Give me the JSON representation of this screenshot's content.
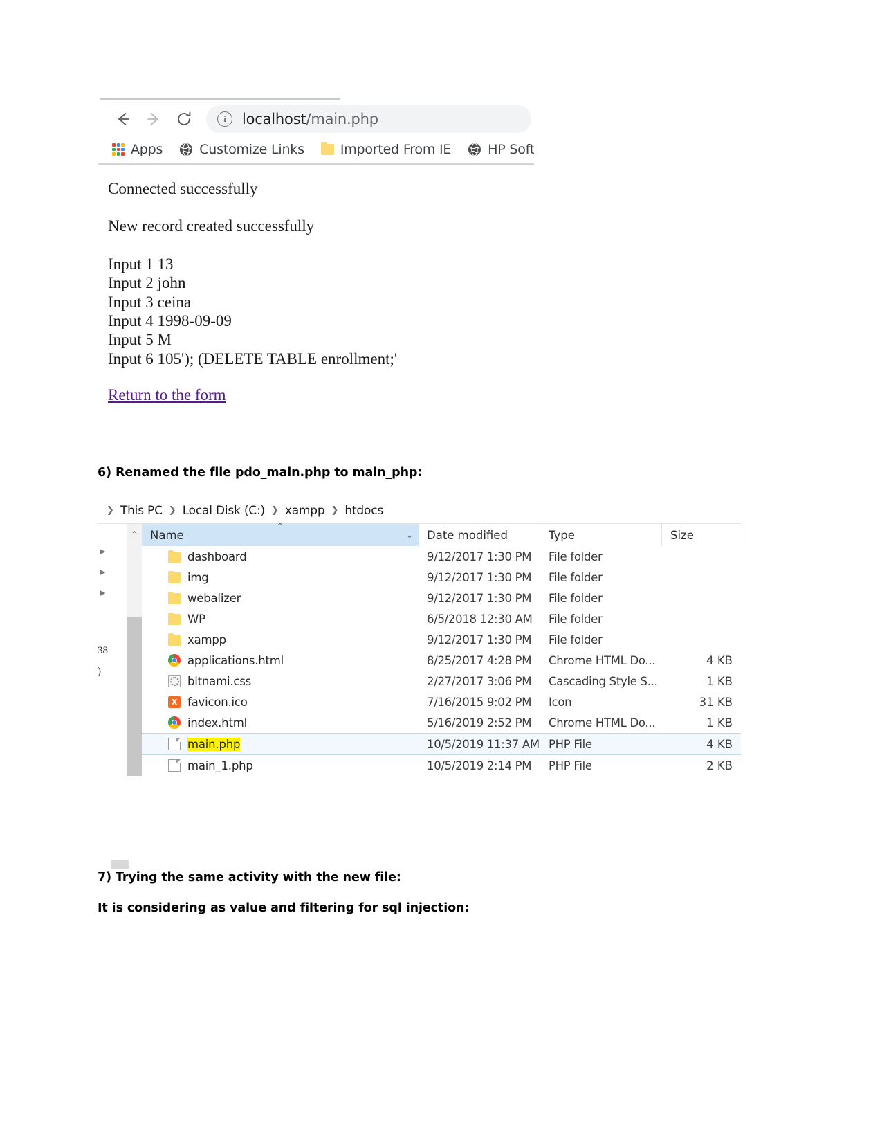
{
  "browser": {
    "nav": {
      "back_label": "←",
      "forward_label": "→",
      "reload_label": "C"
    },
    "omnibox": {
      "info_glyph": "i",
      "url_host": "localhost",
      "url_path": "/main.php"
    },
    "bookmarks": [
      {
        "label": "Apps",
        "icon": "apps-grid-icon"
      },
      {
        "label": "Customize Links",
        "icon": "globe-icon"
      },
      {
        "label": "Imported From IE",
        "icon": "folder-icon"
      },
      {
        "label": "HP Softwar",
        "icon": "globe-icon"
      }
    ],
    "page": {
      "connected_message": "Connected successfully",
      "record_message": "New record created successfully",
      "inputs": [
        "Input 1 13",
        "Input 2 john",
        "Input 3 ceina",
        "Input 4 1998-09-09",
        "Input 5 M",
        "Input 6 105'); (DELETE TABLE enrollment;'"
      ],
      "return_link": "Return to the form"
    }
  },
  "document": {
    "heading6": "6) Renamed the file pdo_main.php to main_php:",
    "heading7": "7) Trying the same activity with the new file:",
    "heading7b": "It is considering as value and filtering for sql injection:"
  },
  "explorer": {
    "breadcrumb": [
      "This PC",
      "Local Disk (C:)",
      "xampp",
      "htdocs"
    ],
    "breadcrumb_separator": "❯",
    "left_rail": {
      "tree_arrows": [
        "▶",
        "▶",
        "▶"
      ],
      "clipped_text": [
        "38",
        ")"
      ]
    },
    "scrollbar": {
      "up_arrow": "⌃"
    },
    "columns": {
      "name": "Name",
      "date_modified": "Date modified",
      "type": "Type",
      "size": "Size",
      "sort_caret": "⌃",
      "drop_caret": "⌄"
    },
    "rows": [
      {
        "name": "dashboard",
        "icon": "folder-icon",
        "date": "9/12/2017 1:30 PM",
        "type": "File folder",
        "size": "",
        "selected": false,
        "highlighted": false
      },
      {
        "name": "img",
        "icon": "folder-icon",
        "date": "9/12/2017 1:30 PM",
        "type": "File folder",
        "size": "",
        "selected": false,
        "highlighted": false
      },
      {
        "name": "webalizer",
        "icon": "folder-icon",
        "date": "9/12/2017 1:30 PM",
        "type": "File folder",
        "size": "",
        "selected": false,
        "highlighted": false
      },
      {
        "name": "WP",
        "icon": "folder-icon",
        "date": "6/5/2018 12:30 AM",
        "type": "File folder",
        "size": "",
        "selected": false,
        "highlighted": false
      },
      {
        "name": "xampp",
        "icon": "folder-icon",
        "date": "9/12/2017 1:30 PM",
        "type": "File folder",
        "size": "",
        "selected": false,
        "highlighted": false
      },
      {
        "name": "applications.html",
        "icon": "chrome-icon",
        "date": "8/25/2017 4:28 PM",
        "type": "Chrome HTML Do...",
        "size": "4 KB",
        "selected": false,
        "highlighted": false
      },
      {
        "name": "bitnami.css",
        "icon": "css-file-icon",
        "date": "2/27/2017 3:06 PM",
        "type": "Cascading Style S...",
        "size": "1 KB",
        "selected": false,
        "highlighted": false
      },
      {
        "name": "favicon.ico",
        "icon": "xampp-icon",
        "date": "7/16/2015 9:02 PM",
        "type": "Icon",
        "size": "31 KB",
        "selected": false,
        "highlighted": false
      },
      {
        "name": "index.html",
        "icon": "chrome-icon",
        "date": "5/16/2019 2:52 PM",
        "type": "Chrome HTML Do...",
        "size": "1 KB",
        "selected": false,
        "highlighted": false
      },
      {
        "name": "main.php",
        "icon": "php-file-icon",
        "date": "10/5/2019 11:37 AM",
        "type": "PHP File",
        "size": "4 KB",
        "selected": true,
        "highlighted": true
      },
      {
        "name": "main_1.php",
        "icon": "php-file-icon",
        "date": "10/5/2019 2:14 PM",
        "type": "PHP File",
        "size": "2 KB",
        "selected": false,
        "highlighted": false
      }
    ]
  },
  "colors": {
    "highlight": "#fff200",
    "selection": "#f2f8fe",
    "header_blue": "#cfe4f7",
    "link_purple": "#551a8b"
  }
}
